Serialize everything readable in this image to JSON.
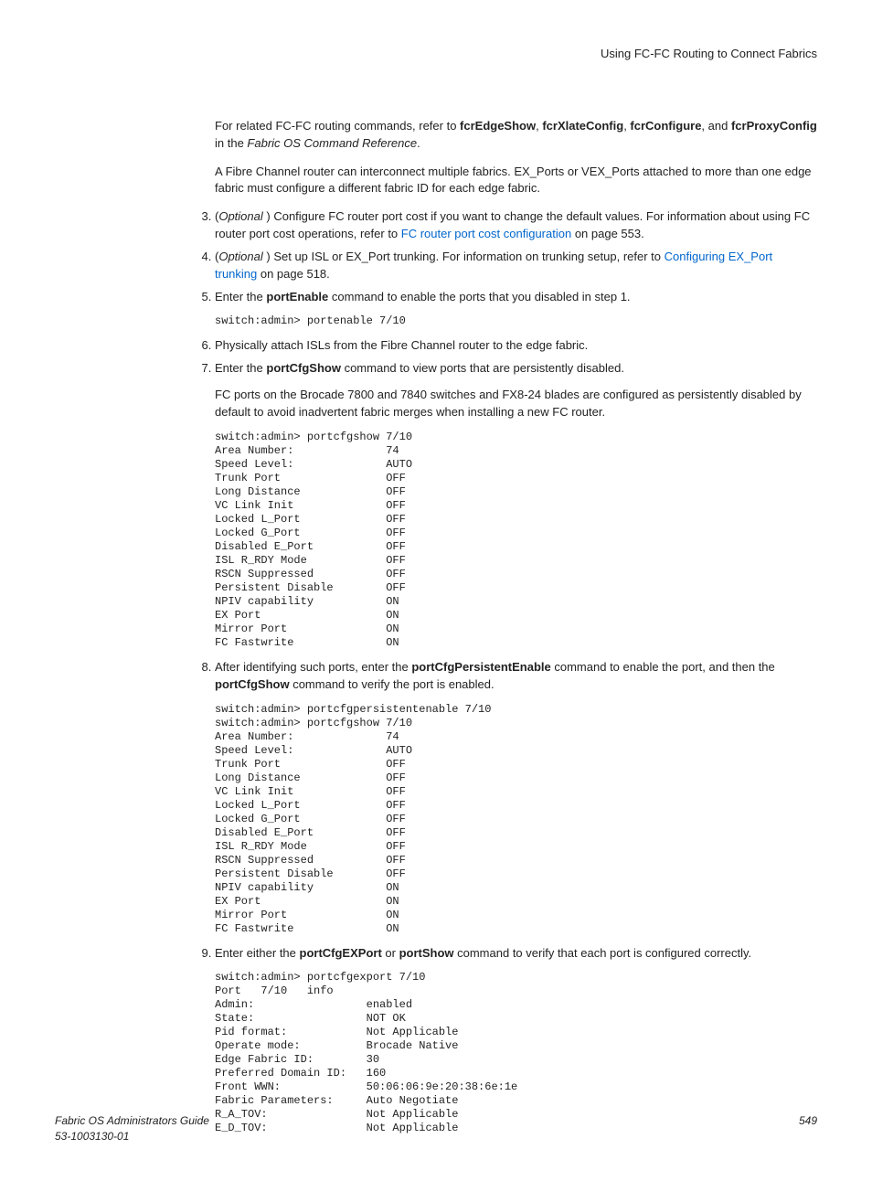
{
  "header": "Using FC-FC Routing to Connect Fabrics",
  "intro1_a": "For related FC-FC routing commands, refer to ",
  "intro1_b": "fcrEdgeShow",
  "intro1_c": ", ",
  "intro1_d": "fcrXlateConfig",
  "intro1_e": ", ",
  "intro1_f": "fcrConfigure",
  "intro1_g": ", and ",
  "intro1_h": "fcrProxyConfig",
  "intro1_i": " in the ",
  "intro1_j": "Fabric OS Command Reference",
  "intro1_k": ".",
  "intro2": "A Fibre Channel router can interconnect multiple fabrics. EX_Ports or VEX_Ports attached to more than one edge fabric must configure a different fabric ID for each edge fabric.",
  "li3_a": "(",
  "li3_b": "Optional ",
  "li3_c": ") Configure FC router port cost if you want to change the default values. For information about using FC router port cost operations, refer to ",
  "li3_link": "FC router port cost configuration",
  "li3_d": " on page 553.",
  "li4_a": "(",
  "li4_b": "Optional ",
  "li4_c": ") Set up ISL or EX_Port trunking. For information on trunking setup, refer to ",
  "li4_link": "Configuring EX_Port trunking",
  "li4_d": " on page 518.",
  "li5_a": "Enter the ",
  "li5_b": "portEnable",
  "li5_c": " command to enable the ports that you disabled in step 1.",
  "code5": "switch:admin> portenable 7/10",
  "li6": "Physically attach ISLs from the Fibre Channel router to the edge fabric.",
  "li7_a": "Enter the ",
  "li7_b": "portCfgShow",
  "li7_c": " command to view ports that are persistently disabled.",
  "li7_para": "FC ports on the Brocade 7800 and 7840 switches and FX8-24 blades are configured as persistently disabled by default to avoid inadvertent fabric merges when installing a new FC router.",
  "code7": "switch:admin> portcfgshow 7/10\nArea Number:              74\nSpeed Level:              AUTO\nTrunk Port                OFF\nLong Distance             OFF\nVC Link Init              OFF\nLocked L_Port             OFF\nLocked G_Port             OFF\nDisabled E_Port           OFF\nISL R_RDY Mode            OFF\nRSCN Suppressed           OFF\nPersistent Disable        OFF\nNPIV capability           ON\nEX Port                   ON\nMirror Port               ON\nFC Fastwrite              ON",
  "li8_a": "After identifying such ports, enter the ",
  "li8_b": "portCfgPersistentEnable",
  "li8_c": " command to enable the port, and then the ",
  "li8_d": "portCfgShow",
  "li8_e": " command to verify the port is enabled.",
  "code8": "switch:admin> portcfgpersistentenable 7/10\nswitch:admin> portcfgshow 7/10\nArea Number:              74\nSpeed Level:              AUTO\nTrunk Port                OFF\nLong Distance             OFF\nVC Link Init              OFF\nLocked L_Port             OFF\nLocked G_Port             OFF\nDisabled E_Port           OFF\nISL R_RDY Mode            OFF\nRSCN Suppressed           OFF\nPersistent Disable        OFF\nNPIV capability           ON\nEX Port                   ON\nMirror Port               ON\nFC Fastwrite              ON",
  "li9_a": "Enter either the ",
  "li9_b": "portCfgEXPort",
  "li9_c": " or ",
  "li9_d": "portShow",
  "li9_e": " command to verify that each port is configured correctly.",
  "code9": "switch:admin> portcfgexport 7/10\nPort   7/10   info\nAdmin:                 enabled\nState:                 NOT OK\nPid format:            Not Applicable\nOperate mode:          Brocade Native\nEdge Fabric ID:        30\nPreferred Domain ID:   160\nFront WWN:             50:06:06:9e:20:38:6e:1e\nFabric Parameters:     Auto Negotiate\nR_A_TOV:               Not Applicable\nE_D_TOV:               Not Applicable",
  "footer_title": "Fabric OS Administrators Guide",
  "footer_doc": "53-1003130-01",
  "footer_page": "549"
}
